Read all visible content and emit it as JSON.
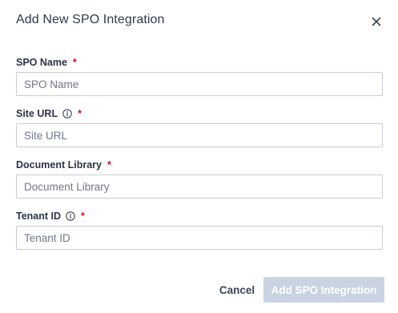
{
  "dialog": {
    "title": "Add New SPO Integration",
    "close_icon": "close-icon"
  },
  "fields": {
    "spo_name": {
      "label": "SPO Name",
      "required_mark": "*",
      "placeholder": "SPO Name",
      "value": ""
    },
    "site_url": {
      "label": "Site URL",
      "info_icon": "info-icon",
      "required_mark": "*",
      "placeholder": "Site URL",
      "value": ""
    },
    "document_library": {
      "label": "Document Library",
      "required_mark": "*",
      "placeholder": "Document Library",
      "value": ""
    },
    "tenant_id": {
      "label": "Tenant ID",
      "info_icon": "info-icon",
      "required_mark": "*",
      "placeholder": "Tenant ID",
      "value": ""
    }
  },
  "footer": {
    "cancel_label": "Cancel",
    "submit_label": "Add SPO Integration",
    "submit_disabled": true
  },
  "colors": {
    "required": "#c8102e",
    "submit_disabled_bg": "#c9d3e2",
    "input_border": "#c8ccd4"
  }
}
